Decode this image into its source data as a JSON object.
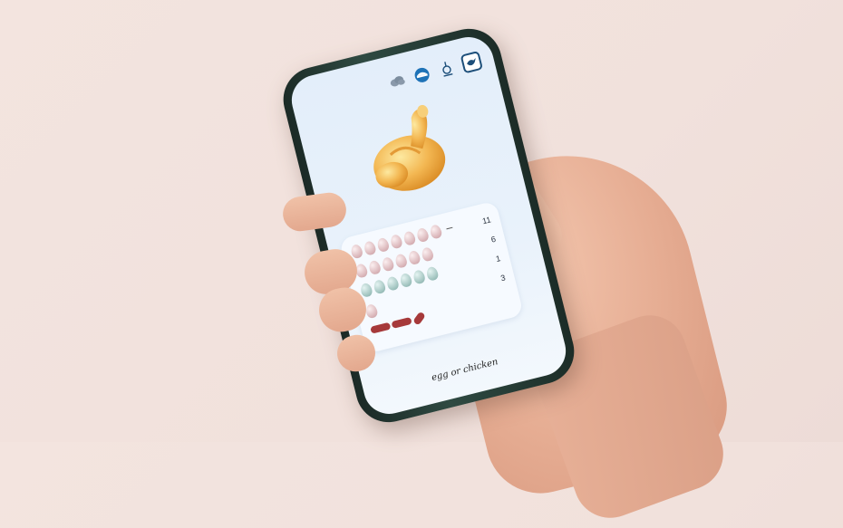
{
  "app": {
    "footer_title": "egg or chicken"
  },
  "toolbar": {
    "icons": [
      "cloud-icon",
      "rice-bowl-icon",
      "kitchen-tool-icon",
      "bird-icon"
    ],
    "active_icon": "bird-icon"
  },
  "hero": {
    "image": "roast-chicken"
  },
  "tally": {
    "rows": [
      {
        "type": "pink-eggs",
        "count_shown": 7,
        "value": "11"
      },
      {
        "type": "pink-eggs",
        "count_shown": 6,
        "value": "6"
      },
      {
        "type": "blue-eggs",
        "count_shown": 6,
        "value": "1"
      },
      {
        "type": "pink-egg",
        "count_shown": 1,
        "value": "3"
      },
      {
        "type": "sausages",
        "count_shown": 3,
        "value": ""
      }
    ]
  },
  "colors": {
    "background": "#f2e3de",
    "screen": "#e6f0fa",
    "accent": "#1d4f7a",
    "sausage": "#a6393a"
  }
}
